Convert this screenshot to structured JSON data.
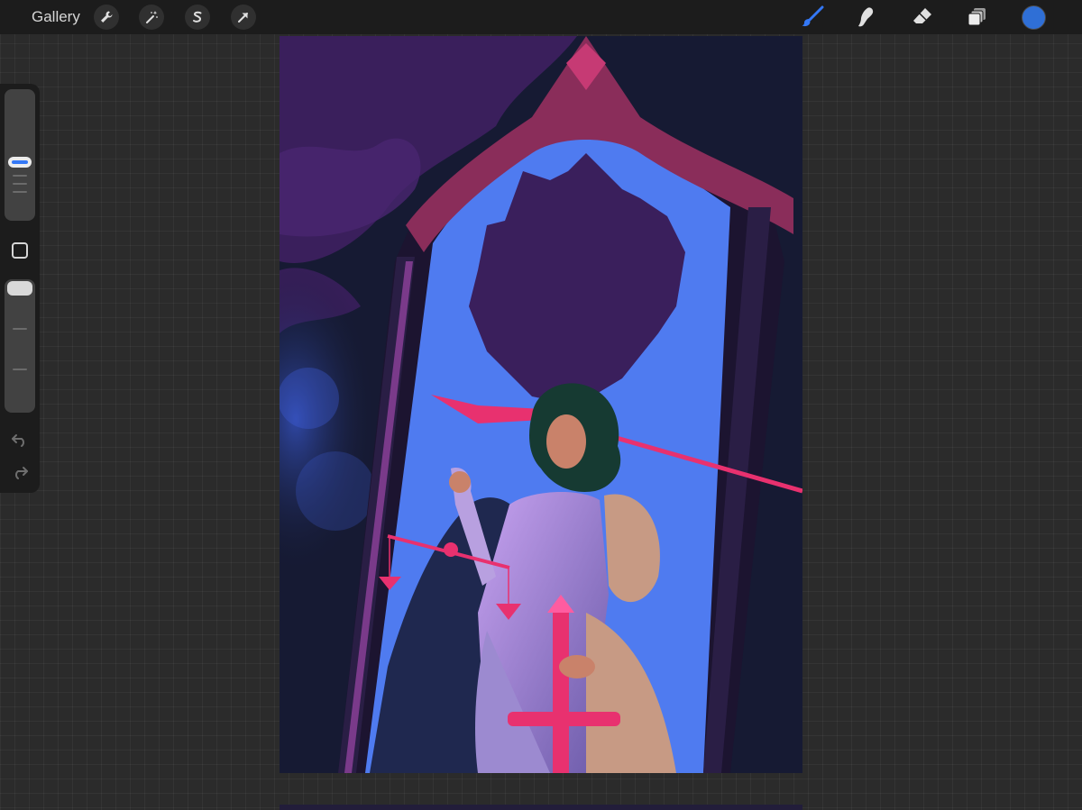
{
  "topbar": {
    "gallery_label": "Gallery",
    "actions": [
      {
        "name": "actions-wrench",
        "icon": "wrench-icon"
      },
      {
        "name": "adjustments-wand",
        "icon": "magic-wand-icon"
      },
      {
        "name": "selection",
        "icon": "selection-s-icon"
      },
      {
        "name": "transform",
        "icon": "transform-arrow-icon"
      }
    ],
    "tools": [
      {
        "name": "brush",
        "icon": "brush-icon",
        "active": true
      },
      {
        "name": "smudge",
        "icon": "smudge-icon",
        "active": false
      },
      {
        "name": "eraser",
        "icon": "eraser-icon",
        "active": false
      },
      {
        "name": "layers",
        "icon": "layers-icon",
        "active": false
      }
    ],
    "current_color": "#2f6fd6"
  },
  "sidebar": {
    "brush_size_level": 0.5,
    "brush_opacity_level": 1.0,
    "modify_button_icon": "square-icon",
    "undo_icon": "undo-icon",
    "redo_icon": "redo-icon"
  },
  "colors": {
    "accent": "#3478f6",
    "artwork_pink": "#e8316f",
    "artwork_blue": "#4f7bf0",
    "artwork_purple": "#3a1f5c"
  }
}
